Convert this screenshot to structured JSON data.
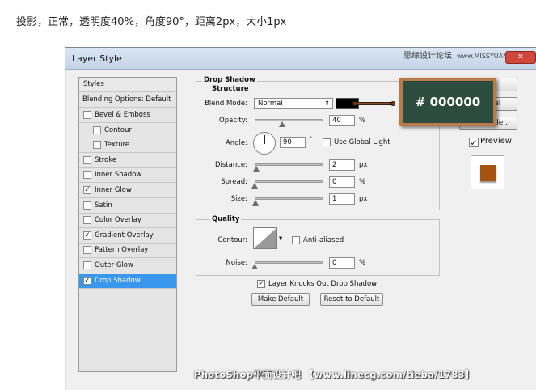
{
  "caption": "投影，正常，透明度40%，角度90°，距离2px，大小1px",
  "window": {
    "title": "Layer Style",
    "site_mark": "思缘设计论坛",
    "site_url": "www.MISSYUAN.COM"
  },
  "styles_panel": {
    "header": "Styles",
    "blending": "Blending Options: Default",
    "items": [
      {
        "label": "Bevel & Emboss",
        "checked": false,
        "indent": false,
        "selected": false
      },
      {
        "label": "Contour",
        "checked": false,
        "indent": true,
        "selected": false
      },
      {
        "label": "Texture",
        "checked": false,
        "indent": true,
        "selected": false
      },
      {
        "label": "Stroke",
        "checked": false,
        "indent": false,
        "selected": false
      },
      {
        "label": "Inner Shadow",
        "checked": false,
        "indent": false,
        "selected": false
      },
      {
        "label": "Inner Glow",
        "checked": true,
        "indent": false,
        "selected": false
      },
      {
        "label": "Satin",
        "checked": false,
        "indent": false,
        "selected": false
      },
      {
        "label": "Color Overlay",
        "checked": false,
        "indent": false,
        "selected": false
      },
      {
        "label": "Gradient Overlay",
        "checked": true,
        "indent": false,
        "selected": false
      },
      {
        "label": "Pattern Overlay",
        "checked": false,
        "indent": false,
        "selected": false
      },
      {
        "label": "Outer Glow",
        "checked": false,
        "indent": false,
        "selected": false
      },
      {
        "label": "Drop Shadow",
        "checked": true,
        "indent": false,
        "selected": true
      }
    ]
  },
  "drop_shadow": {
    "title": "Drop Shadow",
    "structure": "Structure",
    "blend_mode_label": "Blend Mode:",
    "blend_mode": "Normal",
    "color": "#000000",
    "opacity_label": "Opacity:",
    "opacity": "40",
    "opacity_fraction": 0.4,
    "angle_label": "Angle:",
    "angle": "90",
    "degree_unit": "°",
    "use_global_light": "Use Global Light",
    "distance_label": "Distance:",
    "distance": "2",
    "spread_label": "Spread:",
    "spread": "0",
    "size_label": "Size:",
    "size": "1",
    "px": "px",
    "pct": "%",
    "quality": "Quality",
    "contour_label": "Contour:",
    "anti_aliased": "Anti-aliased",
    "noise_label": "Noise:",
    "noise": "0",
    "layer_knocks": "Layer Knocks Out Drop Shadow",
    "make_default": "Make Default",
    "reset_default": "Reset to Default"
  },
  "right_panel": {
    "cancel": "Cancel",
    "new_style": "New Style...",
    "preview": "Preview",
    "preview_color": "#a45311"
  },
  "callout": "# 000000",
  "watermark": "PhotoShop平面设计吧 【www.linecg.com/tieba/1783】"
}
